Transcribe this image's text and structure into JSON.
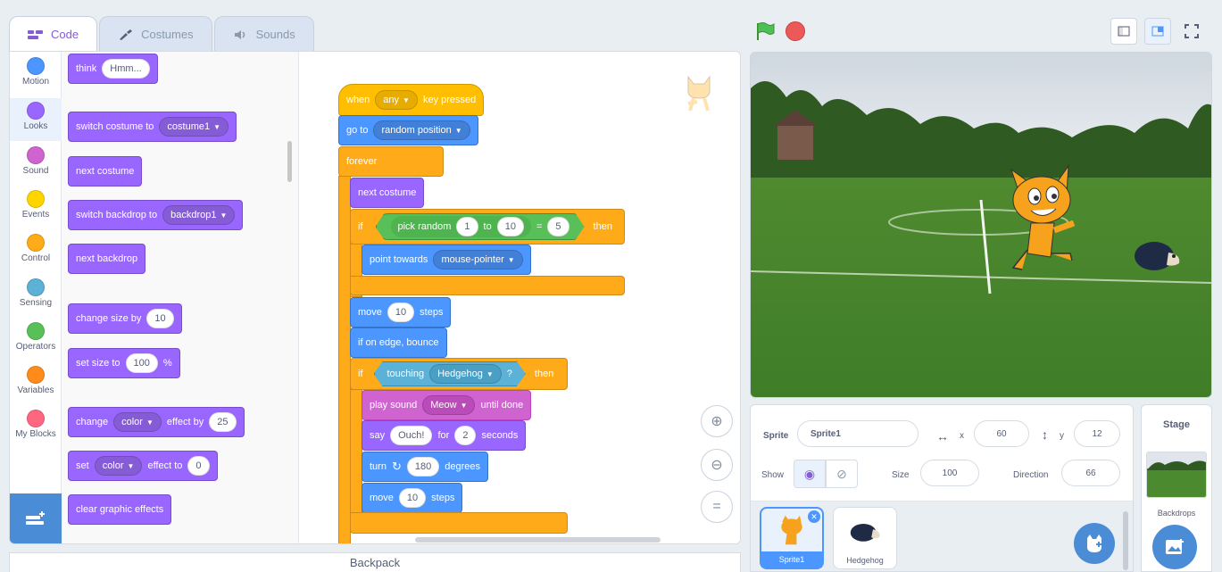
{
  "tabs": [
    {
      "label": "Code",
      "icon": "code-icon",
      "active": true
    },
    {
      "label": "Costumes",
      "icon": "brush-icon",
      "active": false
    },
    {
      "label": "Sounds",
      "icon": "speaker-icon",
      "active": false
    }
  ],
  "categories": [
    {
      "label": "Motion",
      "color": "#4c97ff"
    },
    {
      "label": "Looks",
      "color": "#9966ff"
    },
    {
      "label": "Sound",
      "color": "#cf63cf"
    },
    {
      "label": "Events",
      "color": "#ffd500"
    },
    {
      "label": "Control",
      "color": "#ffab19"
    },
    {
      "label": "Sensing",
      "color": "#5cb1d6"
    },
    {
      "label": "Operators",
      "color": "#59c059"
    },
    {
      "label": "Variables",
      "color": "#ff8c1a"
    },
    {
      "label": "My Blocks",
      "color": "#ff6680"
    }
  ],
  "palette": {
    "think": "think",
    "think_value": "Hmm...",
    "switch_costume": "switch costume to",
    "costume": "costume1",
    "next_costume": "next costume",
    "switch_backdrop": "switch backdrop to",
    "backdrop": "backdrop1",
    "next_backdrop": "next backdrop",
    "change_size": "change size by",
    "change_size_value": "10",
    "set_size": "set size to",
    "set_size_value": "100",
    "percent": "%",
    "change_effect": "change",
    "effect": "color",
    "effect_by": "effect by",
    "effect_by_value": "25",
    "set_effect": "set",
    "effect_to": "effect to",
    "effect_to_value": "0",
    "clear_effects": "clear graphic effects"
  },
  "script": {
    "when": "when",
    "key": "any",
    "key_pressed": "key pressed",
    "go_to": "go to",
    "go_to_target": "random position",
    "forever": "forever",
    "next_costume": "next costume",
    "if": "if",
    "then": "then",
    "pick_random": "pick random",
    "rand_from": "1",
    "rand_to_word": "to",
    "rand_to": "10",
    "eq": "=",
    "eq_value": "5",
    "point_towards": "point towards",
    "point_target": "mouse-pointer",
    "move": "move",
    "move_steps": "10",
    "steps": "steps",
    "bounce": "if on edge, bounce",
    "touching": "touching",
    "touching_target": "Hedgehog",
    "q": "?",
    "play_sound": "play sound",
    "sound": "Meow",
    "until_done": "until done",
    "say": "say",
    "say_text": "Ouch!",
    "for": "for",
    "say_secs": "2",
    "seconds": "seconds",
    "turn": "turn",
    "turn_deg": "180",
    "degrees": "degrees",
    "move2_steps": "10"
  },
  "zoom": {
    "in": "⊕",
    "out": "⊖",
    "reset": "="
  },
  "backpack": "Backpack",
  "sprite_info": {
    "sprite_label": "Sprite",
    "sprite_name": "Sprite1",
    "x_label": "x",
    "x": "60",
    "y_label": "y",
    "y": "12",
    "show_label": "Show",
    "size_label": "Size",
    "size": "100",
    "direction_label": "Direction",
    "direction": "66"
  },
  "sprites": [
    {
      "name": "Sprite1",
      "selected": true
    },
    {
      "name": "Hedgehog",
      "selected": false
    }
  ],
  "stage_pane": {
    "title": "Stage",
    "backdrops": "Backdrops"
  }
}
